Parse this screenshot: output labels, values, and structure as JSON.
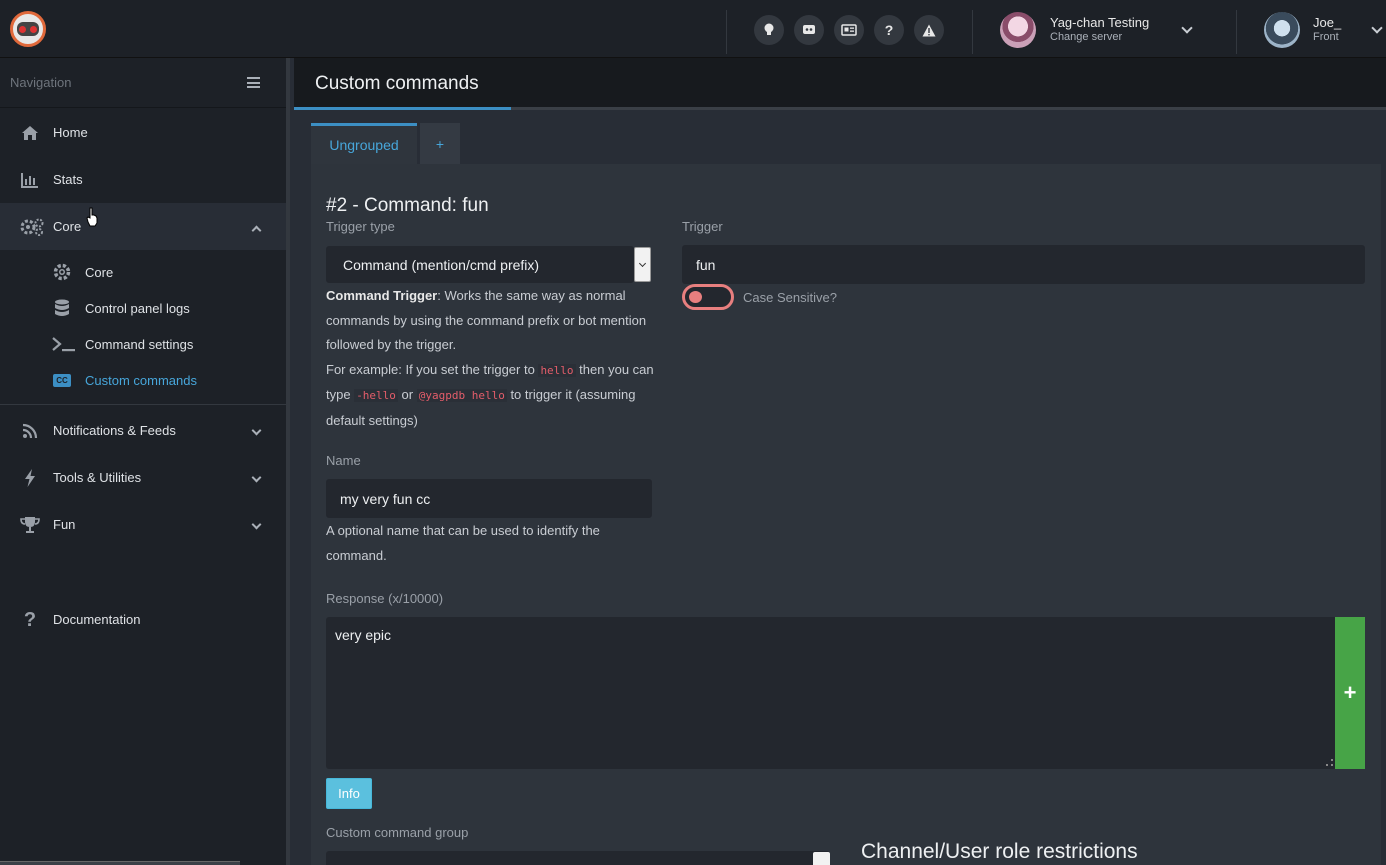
{
  "header": {
    "icons": [
      "lightbulb-icon",
      "discord-icon",
      "news-icon",
      "question-icon",
      "warning-icon"
    ],
    "server": {
      "name": "Yag-chan Testing",
      "sub": "Change server"
    },
    "user": {
      "name": "Joe_",
      "sub": "Front"
    }
  },
  "sidebar": {
    "title": "Navigation",
    "items": [
      {
        "label": "Home",
        "icon": "home-icon"
      },
      {
        "label": "Stats",
        "icon": "bar-chart-icon"
      },
      {
        "label": "Core",
        "icon": "gears-icon"
      }
    ],
    "core_sub": [
      {
        "label": "Core",
        "icon": "gear-icon"
      },
      {
        "label": "Control panel logs",
        "icon": "database-icon"
      },
      {
        "label": "Command settings",
        "icon": "terminal-icon"
      },
      {
        "label": "Custom commands",
        "icon": "cc-icon"
      }
    ],
    "more": [
      {
        "label": "Notifications & Feeds",
        "icon": "rss-icon"
      },
      {
        "label": "Tools & Utilities",
        "icon": "bolt-icon"
      },
      {
        "label": "Fun",
        "icon": "trophy-icon"
      }
    ],
    "doc": {
      "label": "Documentation",
      "icon": "question-icon"
    }
  },
  "page": {
    "title": "Custom commands",
    "tabs": [
      "Ungrouped",
      "+"
    ]
  },
  "command": {
    "heading": "#2 - Command: fun",
    "trigger_type_label": "Trigger type",
    "trigger_type_value": "Command (mention/cmd prefix)",
    "trigger_label": "Trigger",
    "trigger_value": "fun",
    "case_sensitive_label": "Case Sensitive?",
    "help": {
      "bold": "Command Trigger",
      "text1": ": Works the same way as normal commands by using the command prefix or bot mention followed by the trigger.",
      "text2": "For example: If you set the trigger to ",
      "code1": "hello",
      "text3": " then you can type ",
      "code2": "-hello",
      "text4": " or ",
      "code3": "@yagpdb hello",
      "text5": " to trigger it (assuming default settings)"
    },
    "name_label": "Name",
    "name_value": "my very fun cc",
    "name_help": "A optional name that can be used to identify the command.",
    "response_label": "Response (x/10000)",
    "response_value": "very epic",
    "add_label": "+",
    "info_label": "Info",
    "group_label": "Custom command group",
    "restrictions_heading": "Channel/User role restrictions"
  }
}
